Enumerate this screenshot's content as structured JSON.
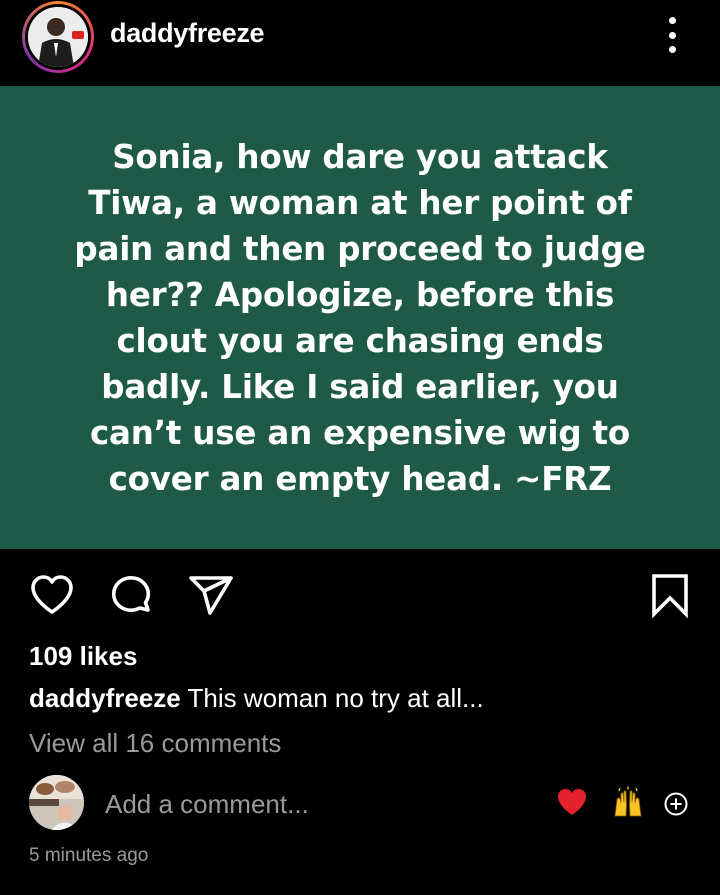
{
  "header": {
    "username": "daddyfreeze",
    "avatar_icon": "profile-photo",
    "more_icon": "more-vertical-icon"
  },
  "post": {
    "background_color": "#1e5a47",
    "text_lines": [
      "Sonia, how dare you attack",
      "Tiwa, a woman at her point of",
      "pain and then proceed to judge",
      "her?? Apologize, before this",
      "clout you are chasing ends",
      "badly. Like I said earlier, you",
      "can’t use an expensive wig to",
      "cover an empty head. ~FRZ"
    ]
  },
  "actions": {
    "like_icon": "heart-outline-icon",
    "comment_icon": "comment-bubble-icon",
    "share_icon": "paper-plane-icon",
    "save_icon": "bookmark-outline-icon"
  },
  "likes": "109 likes",
  "caption": {
    "username": "daddyfreeze",
    "text": "This woman no try at all..."
  },
  "view_comments": "View all 16 comments",
  "add_comment": {
    "placeholder": "Add a comment...",
    "quick_reactions": [
      "❤️",
      "🙌"
    ],
    "plus_icon": "add-circle-icon"
  },
  "timestamp": "5 minutes ago"
}
